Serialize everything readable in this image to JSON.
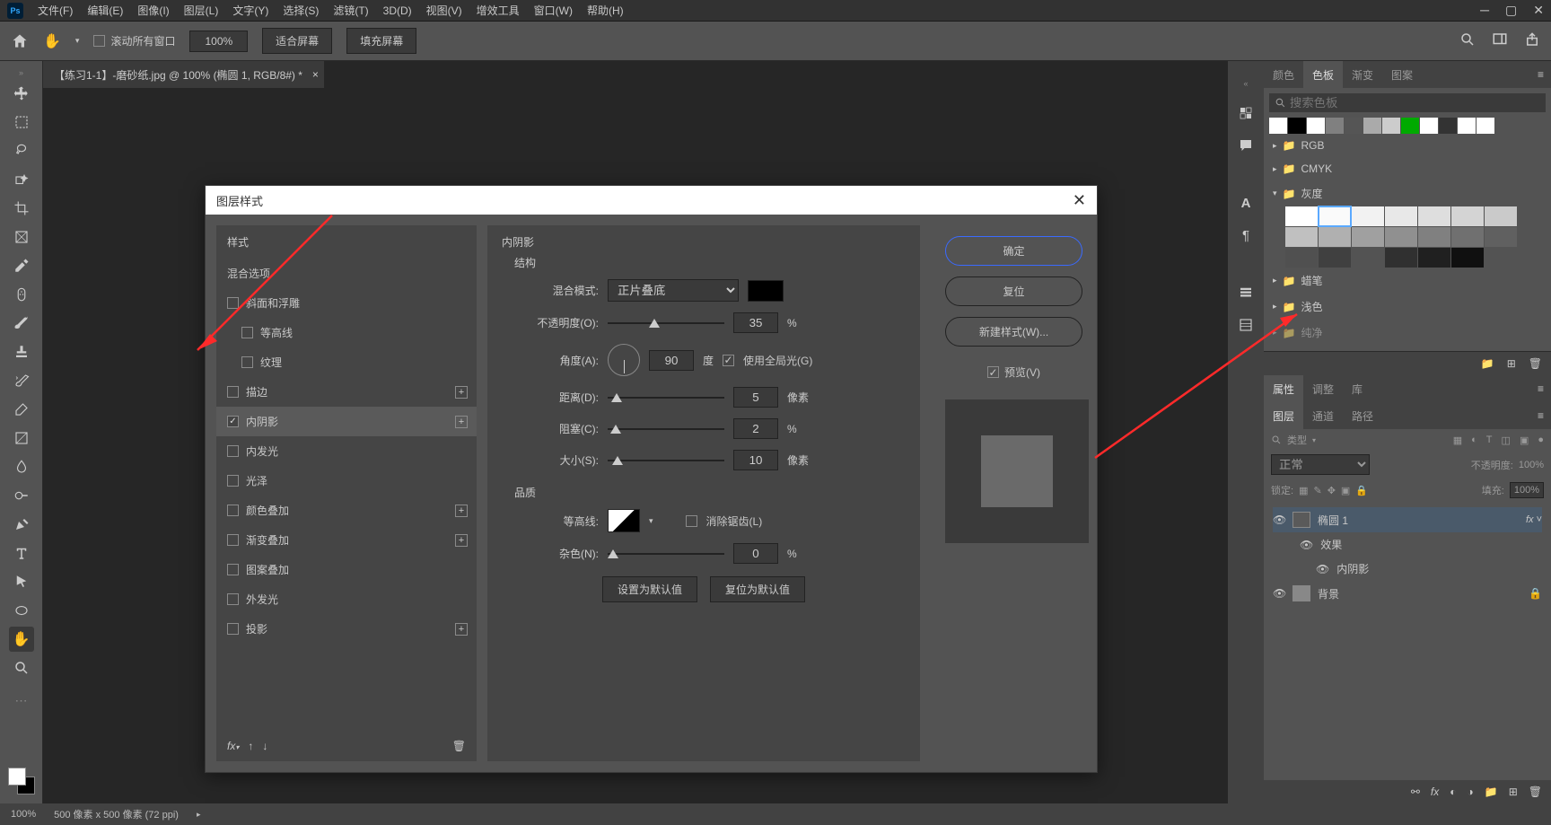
{
  "menubar": {
    "items": [
      "文件(F)",
      "编辑(E)",
      "图像(I)",
      "图层(L)",
      "文字(Y)",
      "选择(S)",
      "滤镜(T)",
      "3D(D)",
      "视图(V)",
      "增效工具",
      "窗口(W)",
      "帮助(H)"
    ]
  },
  "optionsbar": {
    "scroll_all": "滚动所有窗口",
    "zoom": "100%",
    "fit_screen": "适合屏幕",
    "fill_screen": "填充屏幕"
  },
  "document": {
    "tab_title": "【练习1-1】-磨砂纸.jpg @ 100% (椭圆 1, RGB/8#) *"
  },
  "dialog": {
    "title": "图层样式",
    "styles_header": "样式",
    "blend_options": "混合选项",
    "effects": [
      {
        "label": "斜面和浮雕",
        "checked": false,
        "plus": false
      },
      {
        "label": "等高线",
        "checked": false,
        "plus": false,
        "indent": true
      },
      {
        "label": "纹理",
        "checked": false,
        "plus": false,
        "indent": true
      },
      {
        "label": "描边",
        "checked": false,
        "plus": true
      },
      {
        "label": "内阴影",
        "checked": true,
        "plus": true,
        "selected": true
      },
      {
        "label": "内发光",
        "checked": false,
        "plus": false
      },
      {
        "label": "光泽",
        "checked": false,
        "plus": false
      },
      {
        "label": "颜色叠加",
        "checked": false,
        "plus": true
      },
      {
        "label": "渐变叠加",
        "checked": false,
        "plus": true
      },
      {
        "label": "图案叠加",
        "checked": false,
        "plus": false
      },
      {
        "label": "外发光",
        "checked": false,
        "plus": false
      },
      {
        "label": "投影",
        "checked": false,
        "plus": true
      }
    ],
    "settings": {
      "title": "内阴影",
      "structure_label": "结构",
      "blend_mode_label": "混合模式:",
      "blend_mode_value": "正片叠底",
      "opacity_label": "不透明度(O):",
      "opacity_value": "35",
      "opacity_unit": "%",
      "angle_label": "角度(A):",
      "angle_value": "90",
      "angle_unit": "度",
      "global_light": "使用全局光(G)",
      "distance_label": "距离(D):",
      "distance_value": "5",
      "distance_unit": "像素",
      "choke_label": "阻塞(C):",
      "choke_value": "2",
      "choke_unit": "%",
      "size_label": "大小(S):",
      "size_value": "10",
      "size_unit": "像素",
      "quality_label": "品质",
      "contour_label": "等高线:",
      "antialias": "消除锯齿(L)",
      "noise_label": "杂色(N):",
      "noise_value": "0",
      "noise_unit": "%",
      "make_default": "设置为默认值",
      "reset_default": "复位为默认值"
    },
    "buttons": {
      "ok": "确定",
      "cancel": "复位",
      "new_style": "新建样式(W)...",
      "preview": "预览(V)"
    }
  },
  "panels": {
    "swatches_tabs": [
      "颜色",
      "色板",
      "渐变",
      "图案"
    ],
    "search_placeholder": "搜索色板",
    "top_swatches": [
      "#ffffff",
      "#000000",
      "#ffffff",
      "#808080",
      "#555555",
      "#aaaaaa",
      "#cccccc",
      "#00aa00",
      "#ffffff",
      "#333333",
      "#ffffff",
      "#ffffff"
    ],
    "groups": {
      "rgb": "RGB",
      "cmyk": "CMYK",
      "gray": "灰度",
      "crayon": "蜡笔",
      "light": "浅色",
      "more": "纯净"
    },
    "gray_swatches": [
      "#ffffff",
      "#fafafa",
      "#f2f2f2",
      "#e8e8e8",
      "#dedede",
      "#d4d4d4",
      "#cacaca",
      "#c0c0c0",
      "#b0b0b0",
      "#a0a0a0",
      "#909090",
      "#808080",
      "#707070",
      "#606060",
      "#505050",
      "#404040",
      "",
      "#303030",
      "#202020",
      "#101010"
    ],
    "gray_selected_index": 1,
    "props_tabs": [
      "属性",
      "调整",
      "库"
    ],
    "layers_tabs": [
      "图层",
      "通道",
      "路径"
    ],
    "filter_label": "类型",
    "blend_mode": "正常",
    "opacity_label": "不透明度:",
    "opacity_value": "100%",
    "lock_label": "锁定:",
    "fill_label": "填充:",
    "fill_value": "100%",
    "layer1": "椭圆 1",
    "layer_fx": "效果",
    "layer_fx_inner": "内阴影",
    "layer_bg": "背景"
  },
  "statusbar": {
    "zoom": "100%",
    "dims": "500 像素 x 500 像素 (72 ppi)"
  }
}
